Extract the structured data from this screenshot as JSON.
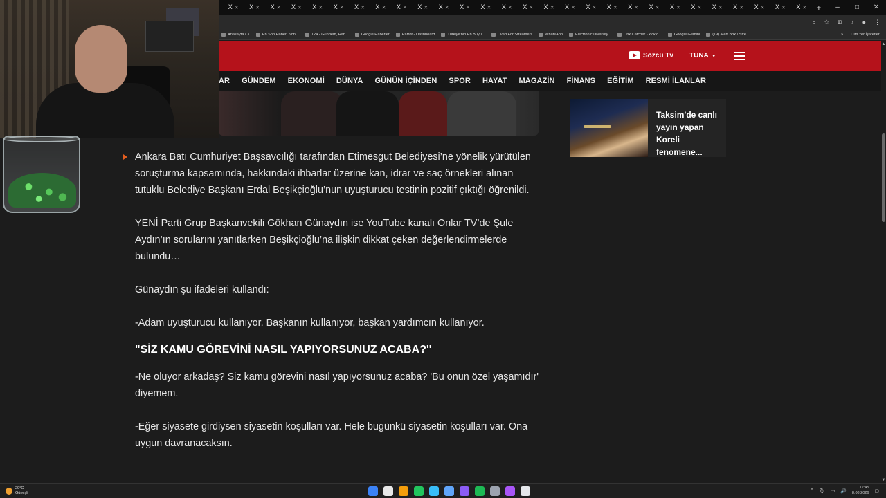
{
  "browser": {
    "tabs": [
      "X",
      "X",
      "X",
      "X",
      "X",
      "X",
      "X",
      "X",
      "X",
      "X",
      "X",
      "X",
      "X",
      "X",
      "X",
      "X",
      "X",
      "X",
      "X",
      "X",
      "X",
      "X",
      "X",
      "X",
      "X",
      "X",
      "X",
      "X"
    ],
    "new_tab": "+",
    "window_controls": [
      "–",
      "□",
      "✕"
    ],
    "bookmarks": [
      "Anasayfa / X",
      "En Son Haber: Son...",
      "T24 - Gündem, Hab...",
      "Google Haberler",
      "Parrot - Dashboard",
      "Türkiye'nin En Büyü...",
      "Livad For Streamers",
      "WhatsApp",
      "Electronic Diversity...",
      "Link Catcher - kicklo...",
      "Google Gemini",
      "(19) Alert Box / Stre..."
    ],
    "bookmarks_more": "»",
    "bookmarks_all": "Tüm Yer İşaretleri"
  },
  "site": {
    "tv_label": "Sözcü Tv",
    "user_label": "TUNA",
    "nav": [
      "AR",
      "GÜNDEM",
      "EKONOMİ",
      "DÜNYA",
      "GÜNÜN İÇİNDEN",
      "SPOR",
      "HAYAT",
      "MAGAZİN",
      "FİNANS",
      "EĞİTİM",
      "RESMİ İLANLAR"
    ]
  },
  "article": {
    "lead": "Ankara Batı Cumhuriyet Başsavcılığı tarafından Etimesgut Belediyesi’ne yönelik yürütülen soruşturma kapsamında, hakkındaki ihbarlar üzerine kan, idrar ve saç örnekleri alınan tutuklu Belediye Başkanı Erdal Beşikçioğlu’nun uyuşturucu testinin pozitif çıktığı öğrenildi.",
    "p2": "YENİ Parti Grup Başkanvekili Gökhan Günaydın ise YouTube kanalı Onlar TV’de Şule Aydın’ın sorularını yanıtlarken Beşikçioğlu’na ilişkin dikkat çeken değerlendirmelerde bulundu…",
    "p3": "Günaydın şu ifadeleri kullandı:",
    "p4": "-Adam uyuşturucu kullanıyor. Başkanın kullanıyor, başkan yardımcın kullanıyor.",
    "subhead": "\"SİZ KAMU GÖREVİNİ NASIL YAPIYORSUNUZ ACABA?''",
    "p5": "-Ne oluyor arkadaş? Siz kamu görevini nasıl yapıyorsunuz acaba?  'Bu onun özel yaşamıdır' diyemem.",
    "p6": "-Eğer siyasete girdiysen siyasetin koşulları var. Hele bugünkü siyasetin koşulları var. Ona uygun davranacaksın."
  },
  "sidebar": {
    "card_title": "Taksim'de canlı yayın yapan Koreli fenomene..."
  },
  "taskbar": {
    "temperature": "29°C",
    "weather": "Güneşli",
    "time": "12:45",
    "date": "8.08.2026",
    "icon_colors": [
      "#3b82f6",
      "#e8e8e8",
      "#f59e0b",
      "#22c55e",
      "#38bdf8",
      "#60a5fa",
      "#8b5cf6",
      "#1db954",
      "#9ca3af",
      "#a855f7",
      "#e5e7eb"
    ]
  },
  "colors": {
    "brand_red": "#b5121b",
    "bullet_orange": "#e35d1f",
    "page_bg": "#1c1c1c"
  }
}
